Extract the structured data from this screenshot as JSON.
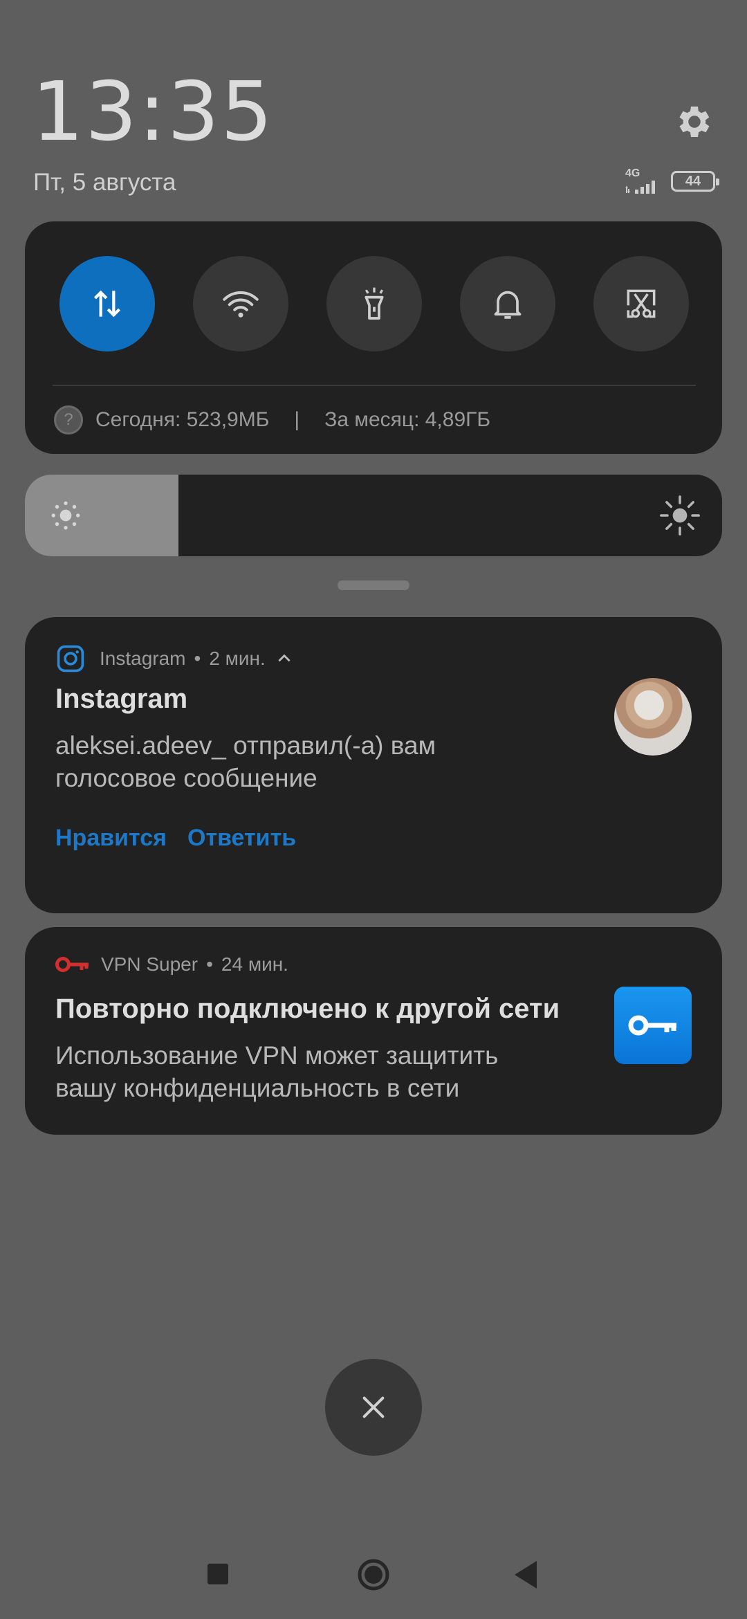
{
  "status": {
    "time": "13:35",
    "date": "Пт, 5 августа",
    "network": "4G",
    "battery": "44"
  },
  "quick_settings": {
    "toggles": [
      {
        "name": "mobile-data",
        "icon": "data-arrows-icon",
        "active": true
      },
      {
        "name": "wifi",
        "icon": "wifi-icon",
        "active": false
      },
      {
        "name": "flashlight",
        "icon": "flashlight-icon",
        "active": false
      },
      {
        "name": "sound",
        "icon": "bell-icon",
        "active": false
      },
      {
        "name": "screenshot",
        "icon": "screenshot-scissors-icon",
        "active": false
      }
    ],
    "usage_today": "Сегодня: 523,9МБ",
    "usage_separator": "|",
    "usage_month": "За месяц: 4,89ГБ",
    "help_glyph": "?"
  },
  "brightness": {
    "level": 0.22
  },
  "notifications": [
    {
      "app": "Instagram",
      "time": "2 мин.",
      "title": "Instagram",
      "body_line1": "aleksei.adeev_ отправил(-а) вам",
      "body_line2": "голосовое сообщение",
      "actions": [
        "Нравится",
        "Ответить"
      ]
    },
    {
      "app": "VPN Super",
      "time": "24 мин.",
      "title": "Повторно подключено к другой сети",
      "body_line1": "Использование VPN может защитить",
      "body_line2": "вашу конфиденциальность в сети"
    }
  ],
  "separator_dot": "•",
  "colors": {
    "accent": "#0f6fbf",
    "action_text": "#1d78c7",
    "vpn_red": "#d32f2f",
    "panel_bg": "#212121",
    "page_bg": "#5e5e5e"
  }
}
